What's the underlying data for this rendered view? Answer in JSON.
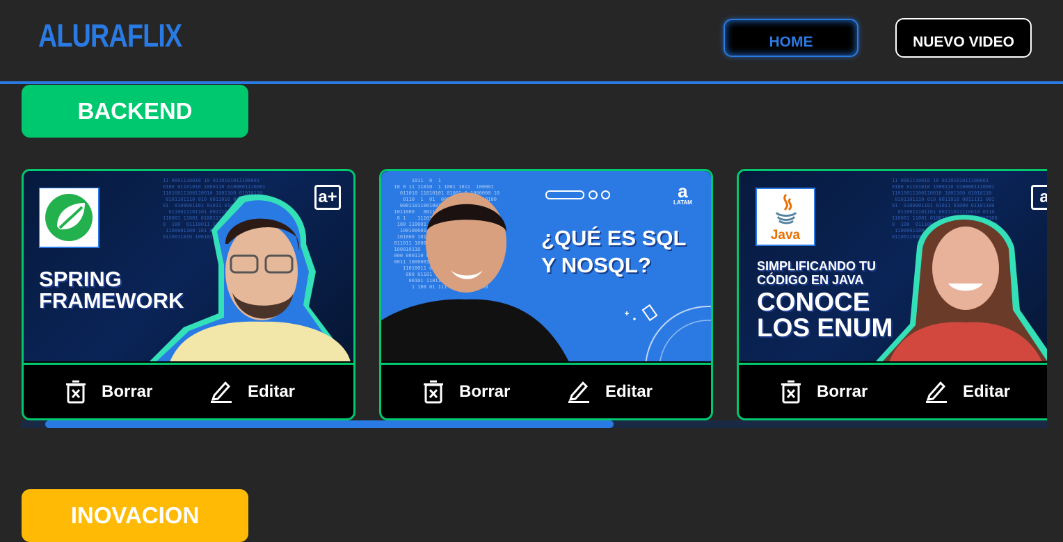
{
  "header": {
    "logo": "ALURAFLIX",
    "home_label": "HOME",
    "new_video_label": "NUEVO VIDEO"
  },
  "categories": [
    {
      "name": "BACKEND",
      "color": "#00C86F",
      "videos": [
        {
          "thumb_title": [
            "SPRING",
            "FRAMEWORK"
          ],
          "brand": "a+",
          "logo": "spring-logo"
        },
        {
          "thumb_title": [
            "¿QUÉ ES SQL",
            "Y NOSQL?"
          ],
          "brand": "a",
          "brand_sub": "LATAM"
        },
        {
          "thumb_title": [
            "SIMPLIFICANDO TU",
            "CÓDIGO EN JAVA",
            "CONOCE",
            "LOS ENUM"
          ],
          "brand": "a",
          "logo": "java-logo",
          "logo_text": "Java"
        }
      ]
    },
    {
      "name": "INOVACION",
      "color": "#FFBA05"
    }
  ],
  "actions": {
    "delete_label": "Borrar",
    "edit_label": "Editar"
  },
  "colors": {
    "accent": "#2A7AE4",
    "background": "#262626",
    "backend": "#00C86F",
    "innovation": "#FFBA05"
  }
}
